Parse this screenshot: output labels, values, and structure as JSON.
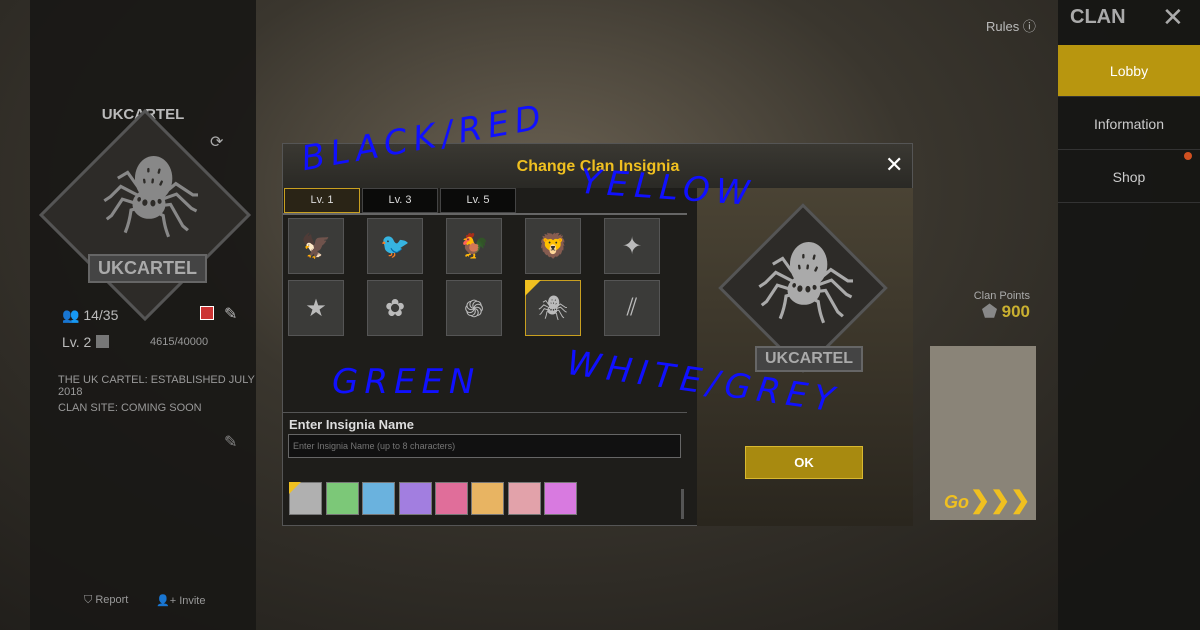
{
  "top": {
    "rules_label": "Rules",
    "help_icon": "question-icon"
  },
  "left_panel": {
    "clan_name": "UKCARTEL",
    "emblem_name": "UKCARTEL",
    "members": "14/35",
    "level": "Lv. 2",
    "exp": "4615/40000",
    "description": "THE UK CARTEL: ESTABLISHED JULY 2018",
    "site": "CLAN SITE: COMING SOON",
    "report_label": "Report",
    "invite_label": "Invite"
  },
  "modal": {
    "title": "Change Clan Insignia",
    "tabs": [
      {
        "label": "Lv. 1"
      },
      {
        "label": "Lv. 3"
      },
      {
        "label": "Lv. 5"
      }
    ],
    "selected_tab": "Lv. 1",
    "name_label": "Enter Insignia Name",
    "name_placeholder": "Enter Insignia Name (up to 8 characters)",
    "ok_label": "OK",
    "preview_name": "UKCARTEL",
    "colors": [
      "#b0b0b0",
      "#7cc878",
      "#6ab2de",
      "#a27ee0",
      "#e06e9a",
      "#e8b462",
      "#e2a2aa",
      "#d87ae0"
    ],
    "selected_color": "#b0b0b0"
  },
  "behind": {
    "clan_points_label": "Clan Points",
    "clan_points": "900",
    "go_label": "Go"
  },
  "sidebar": {
    "title": "CLAN",
    "items": [
      {
        "label": "Lobby"
      },
      {
        "label": "Information"
      },
      {
        "label": "Shop"
      }
    ],
    "active": "Lobby"
  },
  "annotations": [
    "BLACK/RED",
    "YELLOW",
    "GREEN",
    "WHITE/GREY"
  ],
  "accent": "#f0c020"
}
